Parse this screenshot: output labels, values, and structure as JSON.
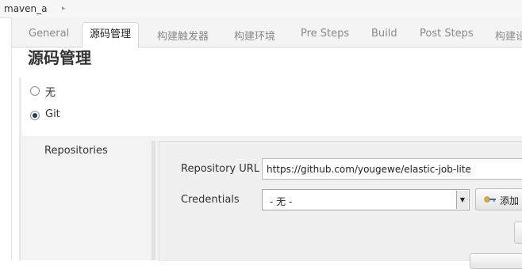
{
  "breadcrumb": {
    "job_name": "maven_a",
    "separator": "▸"
  },
  "tabs": [
    {
      "label": "General"
    },
    {
      "label": "源码管理",
      "active": true
    },
    {
      "label": "构建触发器"
    },
    {
      "label": "构建环境"
    },
    {
      "label": "Pre Steps"
    },
    {
      "label": "Build"
    },
    {
      "label": "Post Steps"
    },
    {
      "label": "构建设"
    }
  ],
  "page_title": "源码管理",
  "scm_options": [
    {
      "label": "无",
      "checked": false
    },
    {
      "label": "Git",
      "checked": true
    }
  ],
  "git": {
    "repositories_label": "Repositories",
    "repository_url_label": "Repository URL",
    "repository_url_value": "https://github.com/yougewe/elastic-job-lite",
    "credentials_label": "Credentials",
    "credentials_selected": "- 无 -",
    "add_button_label": "添加"
  },
  "icons": {
    "breadcrumb_arrow": "chevron-right-icon",
    "credentials_dropdown": "chevron-down-icon",
    "add_credentials": "key-icon"
  },
  "colors": {
    "tab_strip_bg": "#f4f4f4",
    "panel_bg": "#f3f3f3",
    "radio_checked": "#1d3a70"
  }
}
